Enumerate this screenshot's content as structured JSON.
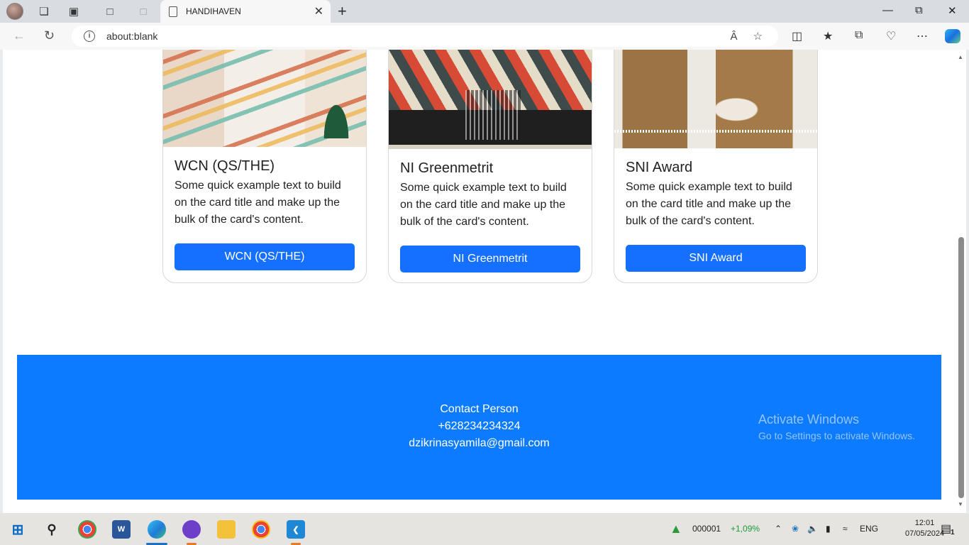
{
  "browser": {
    "tab_title": "HANDIHAVEN",
    "url": "about:blank"
  },
  "cards": [
    {
      "title": "WCN (QS/THE)",
      "text": "Some quick example text to build on the card title and make up the bulk of the card's content.",
      "button": "WCN (QS/THE)"
    },
    {
      "title": "NI Greenmetrit",
      "text": "Some quick example text to build on the card title and make up the bulk of the card's content.",
      "button": "NI Greenmetrit"
    },
    {
      "title": "SNI Award",
      "text": "Some quick example text to build on the card title and make up the bulk of the card's content.",
      "button": "SNI Award"
    }
  ],
  "footer": {
    "contact_label": "Contact Person",
    "phone": "+628234234324",
    "email": "dzikrinasyamila@gmail.com"
  },
  "watermark": {
    "line1": "Activate Windows",
    "line2": "Go to Settings to activate Windows."
  },
  "taskbar": {
    "stock_code": "000001",
    "stock_change": "+1,09%",
    "lang": "ENG",
    "time": "12:01",
    "date": "07/05/2024",
    "notifications": "1"
  },
  "colors": {
    "primary_button": "#1570ff",
    "footer_bg": "#0d7bff",
    "stock_up": "#1a9b3a"
  }
}
